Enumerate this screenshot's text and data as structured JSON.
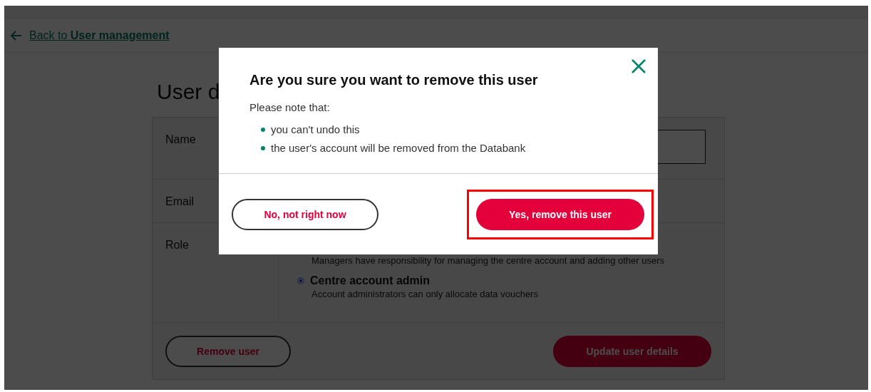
{
  "back_link": {
    "prefix": "Back to",
    "target": "User management"
  },
  "page_title": "User d",
  "form": {
    "name_label": "Name",
    "email_label": "Email",
    "role_label": "Role",
    "role_first_description": "Managers have responsibility for managing the centre account and adding other users",
    "role_option": {
      "label": "Centre account admin",
      "description": "Account administrators can only allocate data vouchers",
      "selected": true
    },
    "remove_button": "Remove user",
    "update_button": {
      "label": "Update user details"
    }
  },
  "dialog": {
    "title": "Are you sure you want to remove this user",
    "intro": "Please note that:",
    "points": [
      "you can't undo this",
      "the user's account will be removed from the Databank"
    ],
    "cancel_button": "No, not right now",
    "confirm_button": {
      "label": "Yes, remove this user",
      "highlighted": true
    }
  }
}
